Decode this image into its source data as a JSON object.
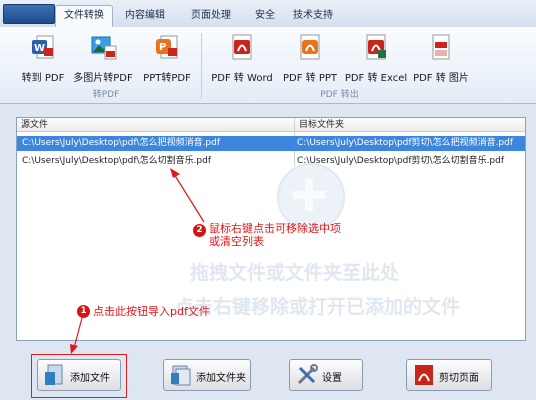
{
  "tabs": [
    "文件转换",
    "内容编辑",
    "页面处理",
    "安全",
    "技术支持"
  ],
  "ribbon": {
    "group1": {
      "label": "转PDF",
      "buttons": [
        "转到 PDF",
        "多图片转PDF",
        "PPT转PDF"
      ]
    },
    "group2": {
      "label": "PDF 转出",
      "buttons": [
        "PDF 转 Word",
        "PDF 转 PPT",
        "PDF 转 Excel",
        "PDF 转 图片"
      ]
    }
  },
  "file_list": {
    "columns": [
      "源文件",
      "目标文件夹"
    ],
    "rows": [
      {
        "source": "C:\\Users\\July\\Desktop\\pdf\\怎么把视频消音.pdf",
        "target": "C:\\Users\\July\\Desktop\\pdf剪切\\怎么把视频消音.pdf",
        "selected": true
      },
      {
        "source": "C:\\Users\\July\\Desktop\\pdf\\怎么切割音乐.pdf",
        "target": "C:\\Users\\July\\Desktop\\pdf剪切\\怎么切割音乐.pdf",
        "selected": false
      }
    ],
    "watermark": [
      "拖拽文件或文件夹至此处",
      "点击右键移除或打开已添加的文件"
    ]
  },
  "annotations": {
    "note1": {
      "badge": "1",
      "text": "点击此按钮导入pdf文件"
    },
    "note2": {
      "badge": "2",
      "line1": "鼠标右键点击可移除选中项",
      "line2": "或清空列表"
    }
  },
  "bottom_buttons": [
    "添加文件",
    "添加文件夹",
    "设置",
    "剪切页面"
  ],
  "colors": {
    "accent_red": "#e01818",
    "selection": "#3d86de"
  },
  "icons": [
    "word-to-pdf-icon",
    "images-to-pdf-icon",
    "ppt-to-pdf-icon",
    "pdf-word-icon",
    "pdf-ppt-icon",
    "pdf-excel-icon",
    "pdf-image-icon",
    "add-file-icon",
    "add-folder-icon",
    "settings-tools-icon",
    "cut-pages-icon"
  ]
}
